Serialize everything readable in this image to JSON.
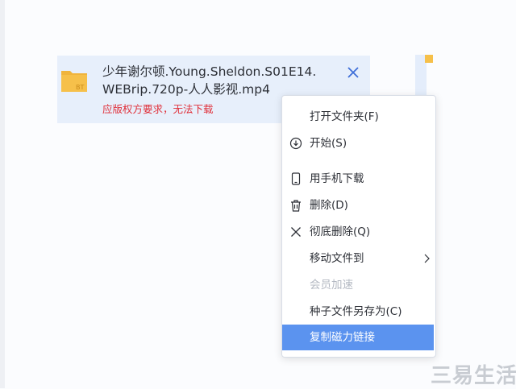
{
  "task": {
    "file_name": "少年谢尔顿.Young.Sheldon.S01E14.WEBrip.720p-人人影视.mp4",
    "error": "应版权方要求，无法下载",
    "folder_badge": "BT"
  },
  "context_menu": {
    "items": [
      {
        "label": "打开文件夹(F)",
        "icon": "none"
      },
      {
        "label": "开始(S)",
        "icon": "download-circle-icon"
      },
      {
        "label": "用手机下载",
        "icon": "phone-icon"
      },
      {
        "label": "删除(D)",
        "icon": "trash-icon"
      },
      {
        "label": "彻底删除(Q)",
        "icon": "x-icon"
      },
      {
        "label": "移动文件到",
        "icon": "none",
        "submenu": true
      },
      {
        "label": "会员加速",
        "icon": "none",
        "disabled": true
      },
      {
        "label": "种子文件另存为(C)",
        "icon": "none"
      },
      {
        "label": "复制磁力链接",
        "icon": "none",
        "highlighted": true
      }
    ]
  },
  "watermark": "三易生活",
  "colors": {
    "card_bg": "#e7effb",
    "error": "#e0303a",
    "highlight": "#5b93ef",
    "folder": "#f6c04a"
  }
}
